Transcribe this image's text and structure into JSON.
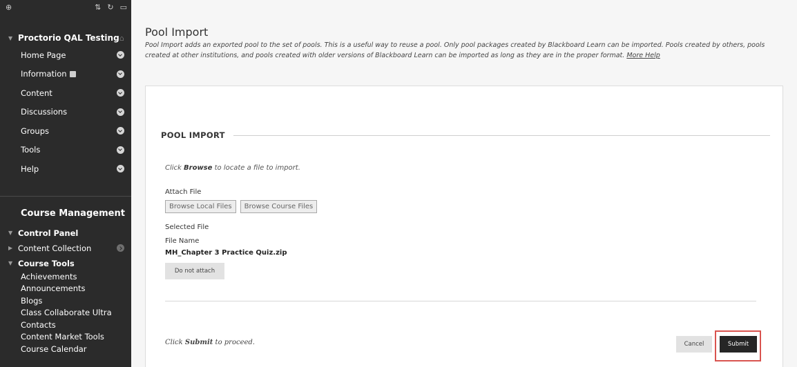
{
  "sidebar": {
    "toolbar": {
      "add_glyph": "⊕",
      "sort_glyph": "⇅",
      "refresh_glyph": "↻",
      "folder_glyph": "▭"
    },
    "course_title": "Proctorio QAL Testing",
    "menu": [
      {
        "label": "Home Page"
      },
      {
        "label": "Information"
      },
      {
        "label": "Content"
      },
      {
        "label": "Discussions"
      },
      {
        "label": "Groups"
      },
      {
        "label": "Tools"
      },
      {
        "label": "Help"
      }
    ],
    "course_management": "Course Management",
    "control_panel": "Control Panel",
    "content_collection": "Content Collection",
    "course_tools": "Course Tools",
    "tools": [
      "Achievements",
      "Announcements",
      "Blogs",
      "Class Collaborate Ultra",
      "Contacts",
      "Content Market Tools",
      "Course Calendar"
    ]
  },
  "main": {
    "title": "Pool Import",
    "description": "Pool Import adds an exported pool to the set of pools. This is a useful way to reuse a pool. Only pool packages created by Blackboard Learn can be imported. Pools created by others, pools created at other institutions, and pools created with older versions of Blackboard Learn can be imported as long as they are in the proper format.",
    "more_help": "More Help",
    "step_title": "POOL IMPORT",
    "instruction_prefix": "Click ",
    "instruction_bold": "Browse",
    "instruction_suffix": " to locate a file to import.",
    "attach_label": "Attach File",
    "browse_local": "Browse Local Files",
    "browse_course": "Browse Course Files",
    "selected_file_label": "Selected File",
    "file_name_label": "File Name",
    "file_name_value": "MH_Chapter 3 Practice Quiz.zip",
    "do_not_attach": "Do not attach",
    "proceed_prefix": "Click ",
    "proceed_bold": "Submit",
    "proceed_suffix": " to proceed.",
    "cancel": "Cancel",
    "submit": "Submit"
  },
  "colors": {
    "sidebar_bg": "#2b2b2b",
    "submit_bg": "#262626",
    "highlight": "#d9534f"
  }
}
